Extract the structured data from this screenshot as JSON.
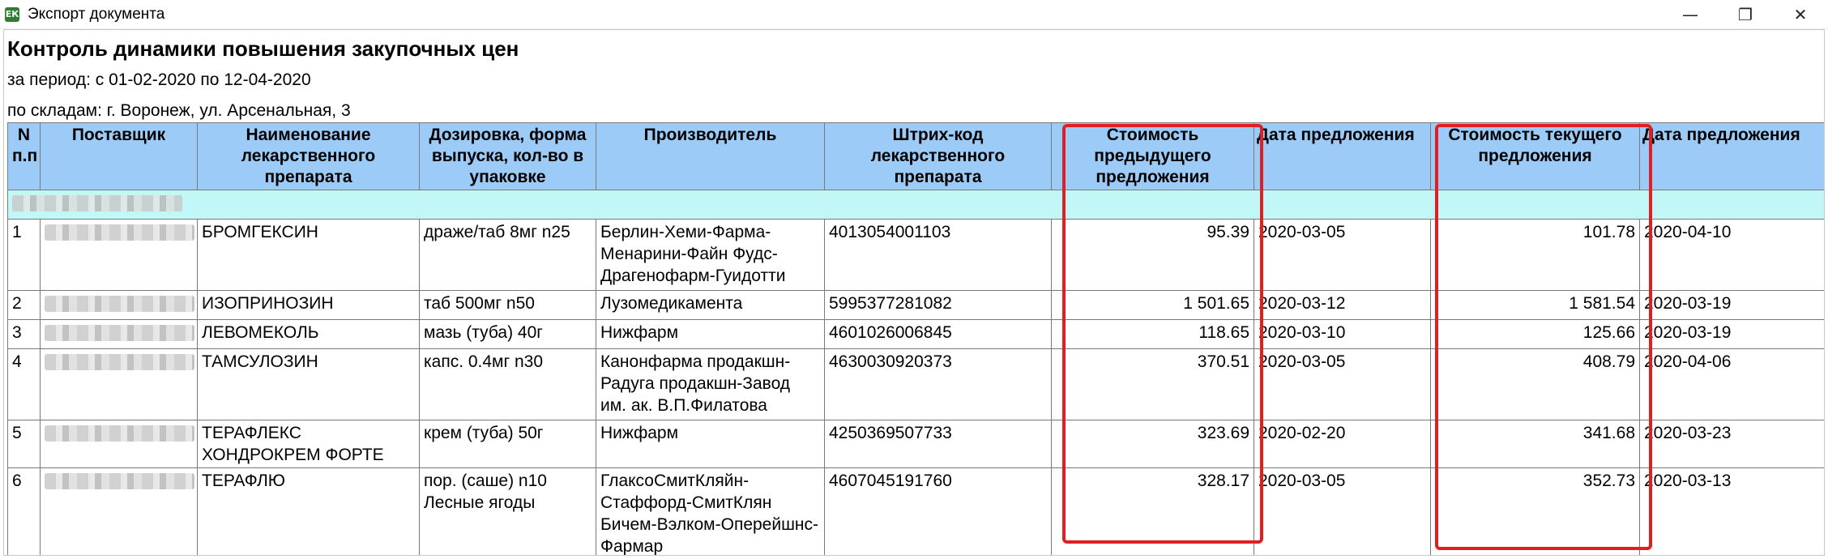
{
  "window": {
    "title": "Экспорт документа",
    "icon_glyph": "ЕК",
    "controls": {
      "minimize": "—",
      "maximize": "❐",
      "close": "✕"
    }
  },
  "report": {
    "title": "Контроль динамики повышения закупочных цен",
    "period": "за период: с 01-02-2020 по 12-04-2020",
    "warehouses": "по складам: г. Воронеж, ул. Арсенальная, 3"
  },
  "table": {
    "headers": {
      "num": "N п.п",
      "supplier": "Поставщик",
      "name": "Наименование лекарственного препарата",
      "dosage": "Дозировка, форма выпуска, кол-во в упаковке",
      "manufacturer": "Производитель",
      "barcode": "Штрих-код лекарственного препарата",
      "prev_price": "Стоимость предыдущего предложения",
      "prev_date": "Дата предложения",
      "cur_price": "Стоимость текущего предложения",
      "cur_date": "Дата предложения"
    },
    "rows": [
      {
        "num": "1",
        "name": "БРОМГЕКСИН",
        "dosage": "драже/таб 8мг n25",
        "manufacturer": "Берлин-Хеми-Фарма-Менарини-Файн Фудс-Драгенофарм-Гуидотти",
        "barcode": "4013054001103",
        "prev_price": "95.39",
        "prev_date": "2020-03-05",
        "cur_price": "101.78",
        "cur_date": "2020-04-10"
      },
      {
        "num": "2",
        "name": "ИЗОПРИНОЗИН",
        "dosage": "таб 500мг n50",
        "manufacturer": "Лузомедикамента",
        "barcode": "5995377281082",
        "prev_price": "1 501.65",
        "prev_date": "2020-03-12",
        "cur_price": "1 581.54",
        "cur_date": "2020-03-19"
      },
      {
        "num": "3",
        "name": "ЛЕВОМЕКОЛЬ",
        "dosage": "мазь (туба) 40г",
        "manufacturer": "Нижфарм",
        "barcode": "4601026006845",
        "prev_price": "118.65",
        "prev_date": "2020-03-10",
        "cur_price": "125.66",
        "cur_date": "2020-03-19"
      },
      {
        "num": "4",
        "name": "ТАМСУЛОЗИН",
        "dosage": "капс. 0.4мг n30",
        "manufacturer": "Канонфарма продакшн-Радуга продакшн-Завод им. ак. В.П.Филатова",
        "barcode": "4630030920373",
        "prev_price": "370.51",
        "prev_date": "2020-03-05",
        "cur_price": "408.79",
        "cur_date": "2020-04-06"
      },
      {
        "num": "5",
        "name": "ТЕРАФЛЕКС ХОНДРОКРЕМ ФОРТЕ",
        "dosage": "крем (туба) 50г",
        "manufacturer": "Нижфарм",
        "barcode": "4250369507733",
        "prev_price": "323.69",
        "prev_date": "2020-02-20",
        "cur_price": "341.68",
        "cur_date": "2020-03-23"
      },
      {
        "num": "6",
        "name": "ТЕРАФЛЮ",
        "dosage": "пор. (саше) n10 Лесные ягоды",
        "manufacturer": "ГлаксоСмитКляйн-Стаффорд-СмитКлян Бичем-Вэлком-Оперейшнс-Фармар",
        "barcode": "4607045191760",
        "prev_price": "328.17",
        "prev_date": "2020-03-05",
        "cur_price": "352.73",
        "cur_date": "2020-03-13"
      }
    ]
  },
  "colors": {
    "header_bg": "#9ccbf7",
    "group_bg": "#c2f7f7",
    "highlight": "#e02020"
  }
}
